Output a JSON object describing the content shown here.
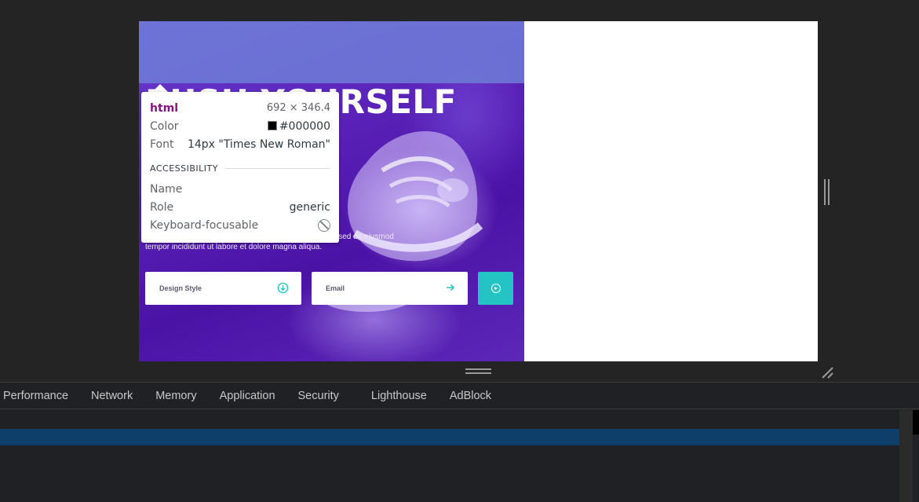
{
  "hero": {
    "title": "PUSH YOURSELF",
    "description": "Lorem ipsum dolor sit amet, consectetur adipiscing elit, sed do eiusmod tempor incididunt ut labore et dolore magna aliqua.",
    "design_style_label": "Design Style",
    "design_style_icon": "arrow-down-circle-icon",
    "email_label": "Email",
    "email_icon": "arrow-right-icon",
    "submit_icon": "play-circle-icon"
  },
  "inspect_tooltip": {
    "tag": "html",
    "size": "692 × 346.4",
    "color_label": "Color",
    "color_value": "#000000",
    "font_label": "Font",
    "font_value": "14px \"Times New Roman\"",
    "section_title": "ACCESSIBILITY",
    "name_label": "Name",
    "name_value": "",
    "role_label": "Role",
    "role_value": "generic",
    "keyboard_label": "Keyboard-focusable",
    "keyboard_icon": "not-focusable-icon"
  },
  "devtools": {
    "tabs": [
      "Performance",
      "Network",
      "Memory",
      "Application",
      "Security",
      "Lighthouse",
      "AdBlock"
    ]
  },
  "colors": {
    "accent_teal": "#25c4c4",
    "hero_purple": "#5a22b8",
    "html_tag": "#881280",
    "devtools_bg": "#202124",
    "selection_row": "#0e3f6b"
  }
}
